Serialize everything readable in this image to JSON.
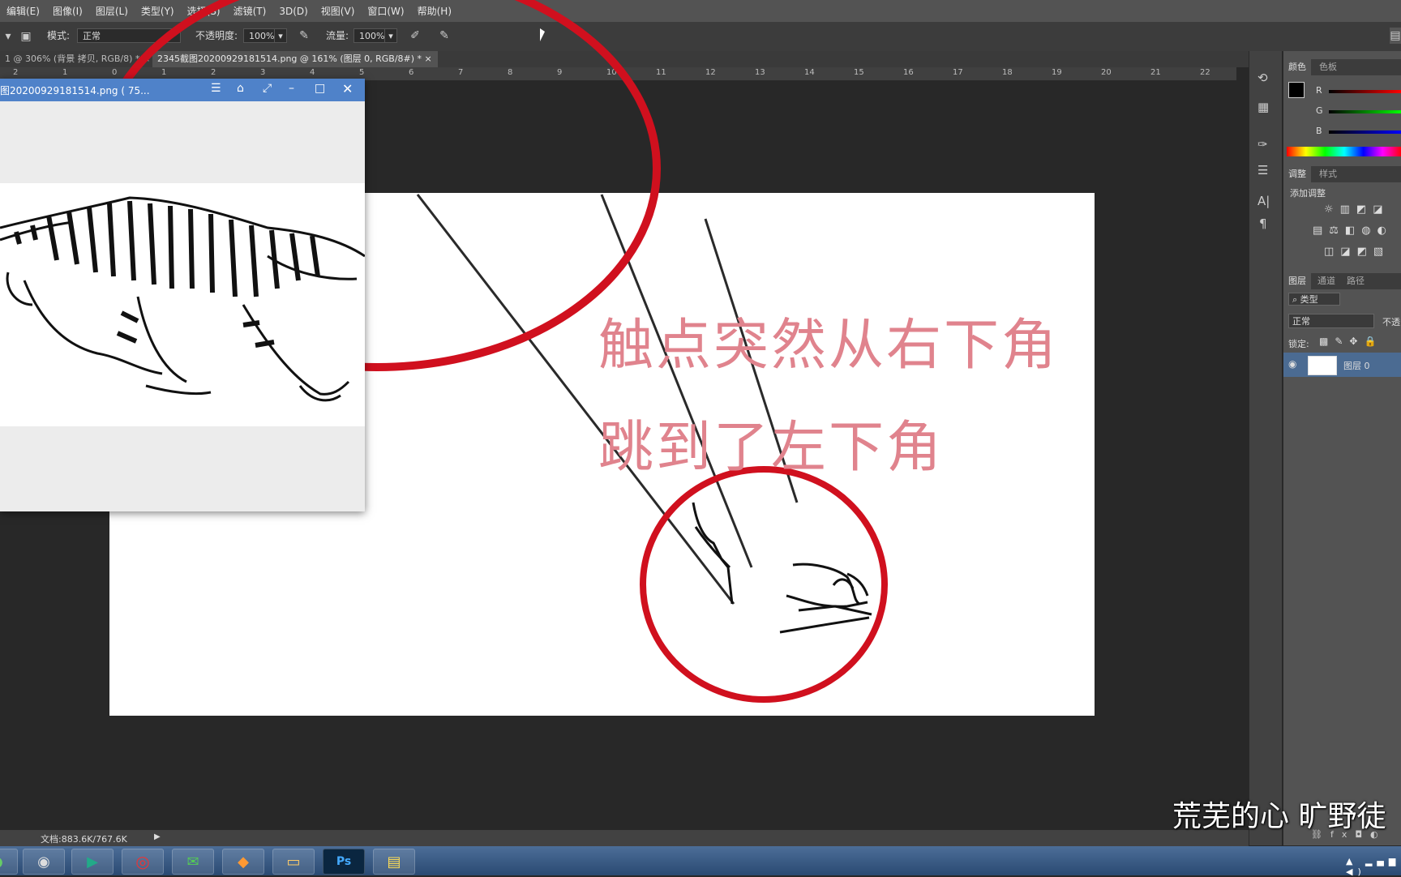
{
  "menubar": {
    "items": [
      "编辑(E)",
      "图像(I)",
      "图层(L)",
      "类型(Y)",
      "选择(S)",
      "滤镜(T)",
      "3D(D)",
      "视图(V)",
      "窗口(W)",
      "帮助(H)"
    ]
  },
  "options": {
    "mode_label": "模式:",
    "mode_value": "正常",
    "opacity_label": "不透明度:",
    "opacity_value": "100%",
    "flow_label": "流量:",
    "flow_value": "100%"
  },
  "tabs": [
    {
      "label": "1 @ 306% (背景 拷贝, RGB/8) *",
      "active": false
    },
    {
      "label": "2345截图20200929181514.png @ 161% (图层 0, RGB/8#) *",
      "active": true
    }
  ],
  "ruler": {
    "ticks": [
      "2",
      "1",
      "0",
      "1",
      "2",
      "3",
      "4",
      "5",
      "6",
      "7",
      "8",
      "9",
      "10",
      "11",
      "12",
      "13",
      "14",
      "15",
      "16",
      "17",
      "18",
      "19",
      "20",
      "21",
      "22"
    ]
  },
  "viewer": {
    "title": "图20200929181514.png ( 75..."
  },
  "captions": {
    "line1": "触点突然从右下角",
    "line2": "跳到了左下角"
  },
  "right_panels": {
    "color_tabs": [
      "颜色",
      "色板"
    ],
    "channels": [
      "R",
      "G",
      "B"
    ],
    "adjust_tabs": [
      "调整",
      "样式"
    ],
    "add_adjustment": "添加调整",
    "layer_tabs": [
      "图层",
      "通道",
      "路径"
    ],
    "kind_filter": "类型",
    "blend_mode": "正常",
    "opacity_short": "不透",
    "lock_label": "锁定:",
    "layer_name": "图层 0"
  },
  "status": {
    "doc_info": "文档:883.6K/767.6K"
  },
  "subtitle": "荒芜的心 旷野徒",
  "colors": {
    "highlight_circle": "#d0101e",
    "caption": "#e0838d",
    "ps_chrome": "#535353"
  }
}
